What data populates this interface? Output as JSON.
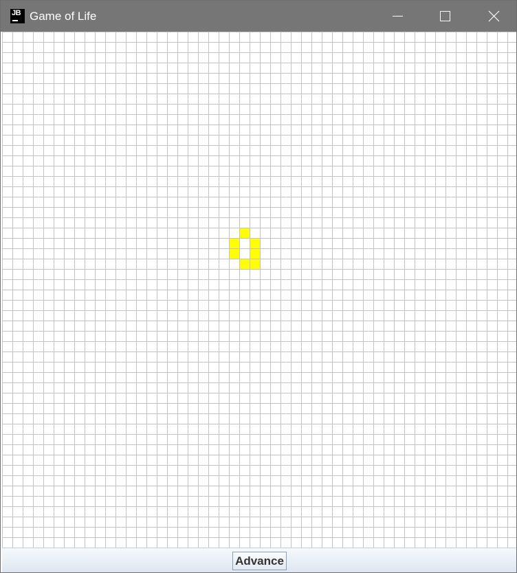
{
  "window": {
    "title": "Game of Life",
    "app_icon_text": "JB",
    "controls": [
      "minimize-icon",
      "maximize-icon",
      "close-icon"
    ]
  },
  "board": {
    "cell_color": "#ffff00",
    "grid_line_color": "#c2c2c2",
    "live_cells": [
      {
        "col": 23,
        "row": 19
      },
      {
        "col": 22,
        "row": 20
      },
      {
        "col": 24,
        "row": 20
      },
      {
        "col": 22,
        "row": 21
      },
      {
        "col": 24,
        "row": 21
      },
      {
        "col": 23,
        "row": 22
      },
      {
        "col": 24,
        "row": 22
      }
    ]
  },
  "controls": {
    "advance_label": "Advance"
  }
}
